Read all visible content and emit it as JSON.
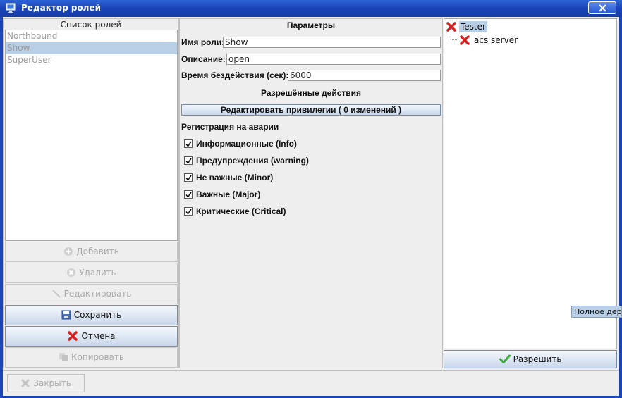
{
  "window": {
    "title": "Редактор ролей"
  },
  "roles_panel": {
    "heading": "Список ролей",
    "roles": [
      "Northbound",
      "Show",
      "SuperUser"
    ],
    "selected": "Show",
    "buttons": {
      "add": "Добавить",
      "delete": "Удалить",
      "edit": "Редактировать",
      "save": "Сохранить",
      "cancel": "Отмена",
      "copy": "Копировать"
    }
  },
  "params_panel": {
    "heading": "Параметры",
    "role_name_label": "Имя роли:",
    "role_name_value": "Show",
    "description_label": "Описание:",
    "description_value": "open",
    "idle_label": "Время бездействия (сек):",
    "idle_value": "6000",
    "allowed_actions_heading": "Разрешённые действия",
    "edit_privileges_button": "Редактировать привилегии ( 0 изменений )",
    "alarm_registration_heading": "Регистрация на аварии",
    "alarm_levels": [
      {
        "label": "Информационные (Info)",
        "checked": true
      },
      {
        "label": "Предупреждения (warning)",
        "checked": true
      },
      {
        "label": "Не важные (Minor)",
        "checked": true
      },
      {
        "label": "Важные (Major)",
        "checked": true
      },
      {
        "label": "Критические (Critical)",
        "checked": true
      }
    ]
  },
  "tree_panel": {
    "root": {
      "label": "Tester",
      "icon": "red-x-icon"
    },
    "children": [
      {
        "label": "acs server",
        "icon": "red-x-icon"
      }
    ],
    "allow_button": "Разрешить",
    "tooltip": "Полное дер"
  },
  "footer": {
    "close_button": "Закрыть"
  },
  "colors": {
    "titlebar": "#1a44b8",
    "selection": "#b8cfe5",
    "deny_red": "#d42020",
    "allow_green": "#3aa83a"
  }
}
